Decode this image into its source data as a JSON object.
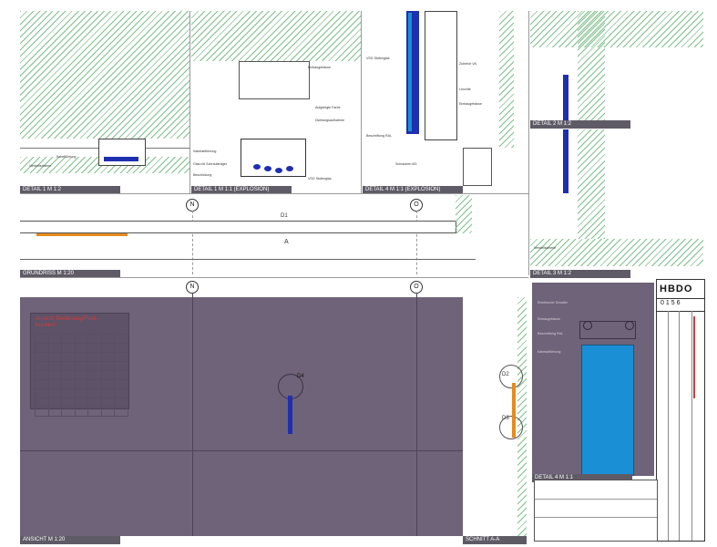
{
  "details": {
    "d1_label": "DETAIL 1   M 1:2",
    "d1_explosion_label": "DETAIL 1   M 1:1  (EXPLOSION)",
    "d4_explosion_label": "DETAIL 4   M 1:1  (EXPLOSION)",
    "d2_label": "DETAIL 2   M 1:2",
    "d3_label": "DETAIL 3   M 1:2",
    "d4_label": "DETAIL 4   M 1:1"
  },
  "plan": {
    "grundriss_label": "GRUNDRISS   M 1:20",
    "ansicht_label": "ANSICHT   M 1:20",
    "schnitt_label": "SCHNITT A-A",
    "axis_n": "N",
    "axis_o": "O",
    "d1_marker": "D1",
    "d2_marker": "D2",
    "d3_marker": "D3",
    "d4_marker": "D4",
    "section_marker": "A"
  },
  "legend": {
    "title_line1": "Ansicht: Bedienung/Funk.",
    "title_line2": "ELEMENT"
  },
  "titleblock": {
    "firm": "HBDO",
    "sheet_no": "0156"
  },
  "colors": {
    "panel": "#6e6378",
    "led_blue": "#1e2fb0",
    "glass_blue": "#1a8fd6",
    "orange": "#e58b1f",
    "hatch_green": "#7fbf8c"
  }
}
